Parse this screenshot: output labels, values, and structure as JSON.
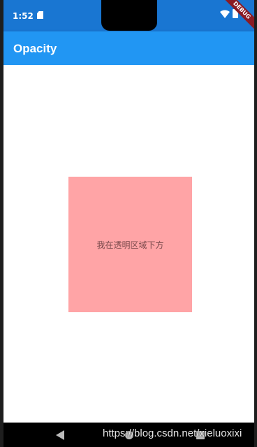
{
  "status_bar": {
    "time": "1:52",
    "sd_icon": "sd-card-icon",
    "wifi_icon": "wifi-icon",
    "battery_icon": "battery-icon"
  },
  "debug_banner": "DEBUG",
  "app_bar": {
    "title": "Opacity"
  },
  "content": {
    "box_text": "我在透明区域下方",
    "box_color": "#ffa4a6"
  },
  "nav_bar": {
    "back_icon": "back-icon",
    "home_icon": "home-icon",
    "recents_icon": "recents-icon"
  },
  "watermark": "https://blog.csdn.net/xieluoxixi",
  "colors": {
    "status_bar": "#1976d2",
    "app_bar": "#2196f3"
  }
}
